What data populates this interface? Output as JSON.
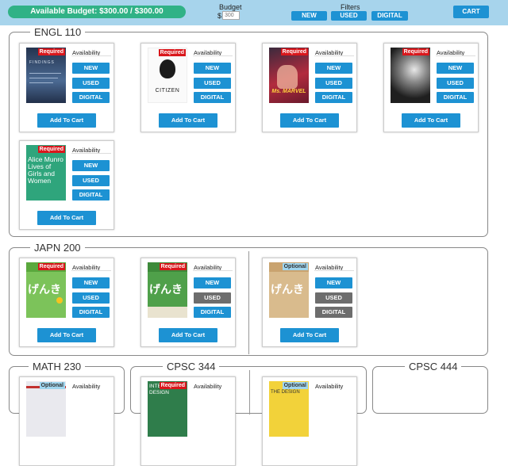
{
  "header": {
    "budget_pill": "Available Budget: $300.00 / $300.00",
    "budget_label": "Budget",
    "budget_currency": "$",
    "budget_placeholder": "300",
    "filters_label": "Filters",
    "filters": [
      "NEW",
      "USED",
      "DIGITAL"
    ],
    "cart_label": "CART"
  },
  "card_labels": {
    "availability": "Availability",
    "new": "NEW",
    "used": "USED",
    "digital": "DIGITAL",
    "add_to_cart": "Add To Cart",
    "required": "Required",
    "optional": "Optional"
  },
  "sections": [
    {
      "title": "ENGL 110",
      "books": [
        {
          "tag": "Required",
          "cover_text": "FINDINGS",
          "cover_color": "#3a4f73"
        },
        {
          "tag": "Required",
          "cover_text": "CITIZEN",
          "cover_color": "#ffffff"
        },
        {
          "tag": "Required",
          "cover_text": "Ms. MARVEL",
          "cover_color": "#8f1f36"
        },
        {
          "tag": "Required",
          "cover_text": "",
          "cover_color": "#2a2a2a"
        },
        {
          "tag": "Required",
          "cover_text": "Alice Munro Lives of Girls and Women",
          "cover_color": "#2fa57c"
        }
      ]
    },
    {
      "title": "JAPN 200",
      "books": [
        {
          "tag": "Required",
          "cover_text": "げんき",
          "cover_color": "#7cc35a",
          "used_available": true
        },
        {
          "tag": "Required",
          "cover_text": "げんき",
          "cover_color": "#4fa04a",
          "used_available": false
        },
        {
          "tag": "Optional",
          "cover_text": "げんき",
          "cover_color": "#d9bb8d",
          "used_available": false
        }
      ]
    },
    {
      "title": "MATH 230",
      "books": [
        {
          "tag": "Optional"
        }
      ]
    },
    {
      "title": "CPSC 344",
      "books": [
        {
          "tag": "Required",
          "cover_text": "INTER DESIGN"
        },
        {
          "tag": "Optional",
          "cover_text": "THE DESIGN"
        }
      ]
    },
    {
      "title": "CPSC 444",
      "books": []
    }
  ]
}
